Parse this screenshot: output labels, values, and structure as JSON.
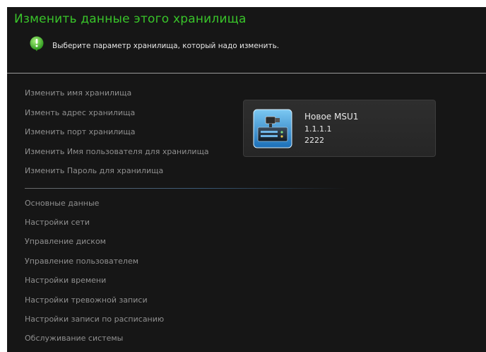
{
  "header": {
    "title": "Изменить данные этого хранилища",
    "hint": "Выберите параметр хранилища, который надо изменить."
  },
  "storage_menu": [
    "Изменить имя хранилища",
    "Изменть адрес хранилища",
    "Изменить порт хранилища",
    "Изменить Имя пользователя для хранилища",
    "Изменить Пароль для хранилища"
  ],
  "settings_menu": [
    "Основные данные",
    "Настройки сети",
    "Управление диском",
    "Управление пользователем",
    "Настройки времени",
    "Настройки тревожной записи",
    "Настройки записи по расписанию",
    "Обслуживание системы"
  ],
  "device": {
    "name": "Новое MSU1",
    "address": "1.1.1.1",
    "port": "2222",
    "icon": "storage-server-icon"
  },
  "colors": {
    "title": "#39c42a",
    "background": "#161616",
    "menu_text": "#8f8f8f"
  }
}
